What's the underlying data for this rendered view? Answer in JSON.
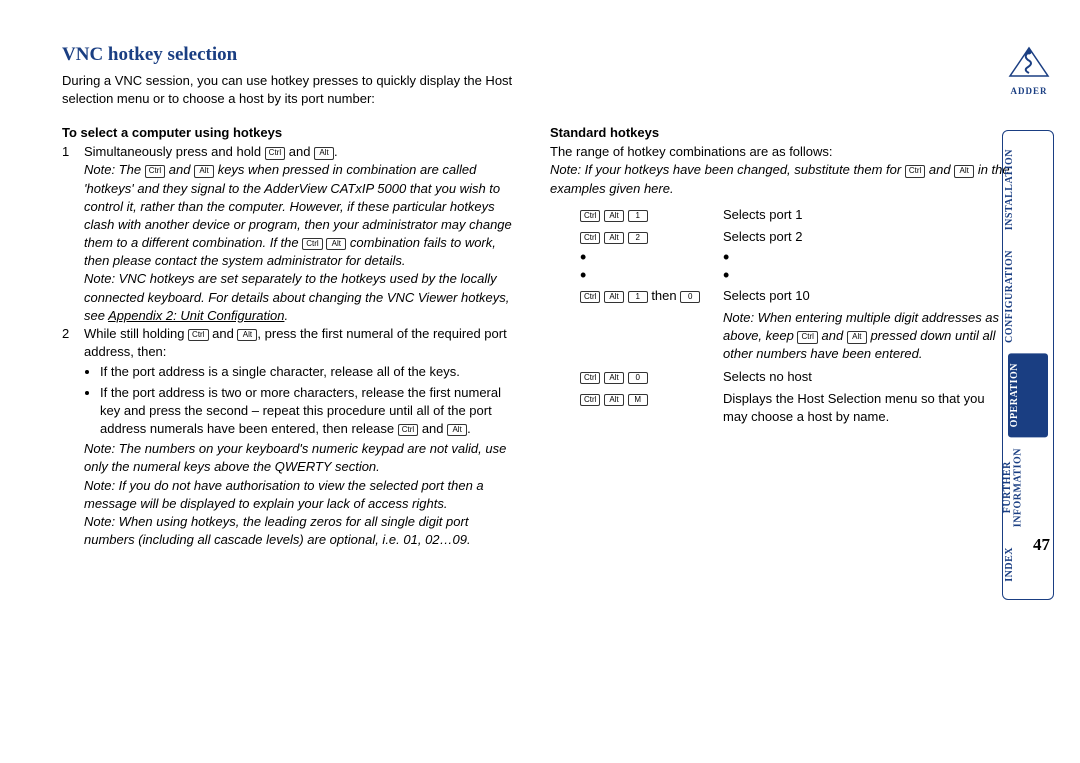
{
  "title": "VNC hotkey selection",
  "intro": "During a VNC session, you can use hotkey presses to quickly display the Host selection menu or to choose a host by its port number:",
  "left": {
    "subhead": "To select a computer using hotkeys",
    "step1_num": "1",
    "step1_text": "Simultaneously press and hold ",
    "step1_and": " and ",
    "step1_end": ".",
    "note1a": "Note: The ",
    "note1b": " and ",
    "note1c": " keys when pressed in combination are called 'hotkeys' and they signal to the AdderView CATxIP 5000 that you wish to control it, rather than the computer. However, if these particular hotkeys clash with another device or program, then your administrator may change them to a different combination. If the ",
    "note1d": " combination fails to work, then please contact the system administrator for details.",
    "note2a": "Note: VNC hotkeys are set separately to the hotkeys used by the locally connected keyboard. For details about changing the VNC Viewer hotkeys, see ",
    "note2_link": "Appendix 2: Unit Configuration",
    "note2b": ".",
    "step2_num": "2",
    "step2a": "While still holding ",
    "step2b": " and ",
    "step2c": ", press the first numeral of the required port address, then:",
    "bullet1": "If the port address is a single character, release all of the keys.",
    "bullet2a": "If the port address is two or more characters, release the first numeral key and press the second – repeat this procedure until all of the port address numerals have been entered, then release ",
    "bullet2b": " and ",
    "bullet2c": ".",
    "note3": "Note: The numbers on your keyboard's numeric keypad are not valid, use only the numeral keys above the QWERTY section.",
    "note4": "Note: If you do not have authorisation to view the selected port then a message will be displayed to explain your lack of access rights.",
    "note5": "Note: When using hotkeys, the leading zeros for all single digit port numbers (including all cascade levels) are optional, i.e. 01, 02…09."
  },
  "right": {
    "subhead": "Standard hotkeys",
    "intro": "The range of hotkey combinations are as follows:",
    "note_a": "Note: If your hotkeys have been changed, substitute them for ",
    "note_b": " and ",
    "note_c": " in the examples given here.",
    "r1_desc": "Selects port 1",
    "r2_desc": "Selects port 2",
    "r3_then": " then ",
    "r3_desc": "Selects port 10",
    "multi_note_a": "Note: When entering multiple digit addresses as above, keep ",
    "multi_note_b": " and ",
    "multi_note_c": " pressed down until all other numbers have been entered.",
    "r4_desc": "Selects no host",
    "r5_desc": "Displays the Host Selection menu so that you may choose a host by name."
  },
  "keys": {
    "ctrl": "Ctrl",
    "alt": "Alt",
    "k1": "1",
    "k2": "2",
    "k0": "0",
    "kM": "M"
  },
  "nav": {
    "installation": "INSTALLATION",
    "configuration": "CONFIGURATION",
    "operation": "OPERATION",
    "further": "FURTHER",
    "information": "INFORMATION",
    "index": "INDEX"
  },
  "logo_text": "ADDER",
  "page_number": "47"
}
